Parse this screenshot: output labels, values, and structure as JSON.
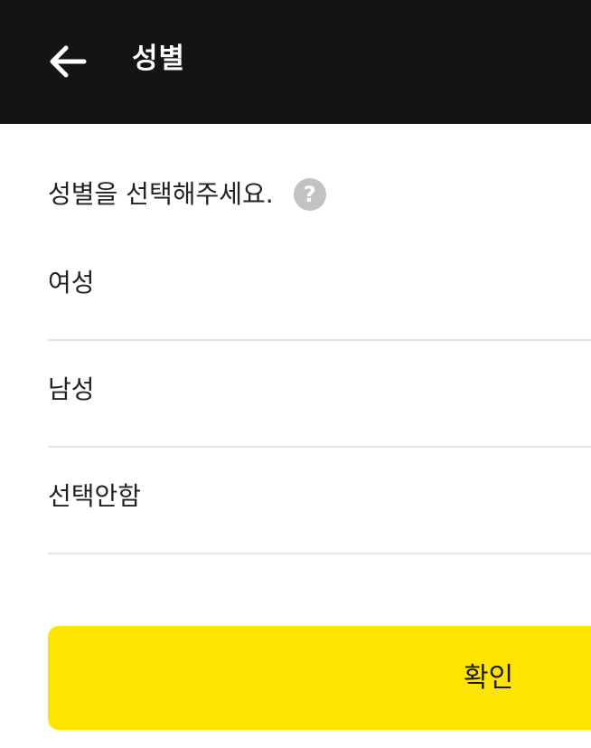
{
  "header": {
    "back_icon": "arrow-left-icon",
    "title": "성별"
  },
  "prompt": {
    "text": "성별을 선택해주세요.",
    "help_icon": "question-circle-icon",
    "help_glyph": "?"
  },
  "options": [
    {
      "label": "여성"
    },
    {
      "label": "남성"
    },
    {
      "label": "선택안함"
    }
  ],
  "confirm": {
    "label": "확인"
  },
  "colors": {
    "header_bg": "#141414",
    "accent": "#fee500",
    "divider": "#e4e4e4",
    "help_icon_bg": "#c2c2c2"
  }
}
